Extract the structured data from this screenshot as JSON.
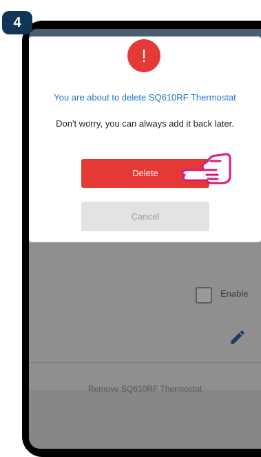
{
  "step_badge": "4",
  "dialog": {
    "title": "You are about to delete SQ610RF Thermostat",
    "message": "Don't worry, you can always add it back later.",
    "delete_label": "Delete",
    "cancel_label": "Cancel",
    "alert_glyph": "!",
    "alert_icon": "exclamation-icon"
  },
  "background": {
    "enable_label": "Enable",
    "enable_checked": false,
    "remove_label": "Remove SQ610RF Thermostat",
    "edit_icon": "pencil-icon"
  },
  "colors": {
    "accent_red": "#e53935",
    "title_blue": "#1e73c8",
    "badge_navy": "#0f3557",
    "hand_outline": "#d81b7e"
  }
}
